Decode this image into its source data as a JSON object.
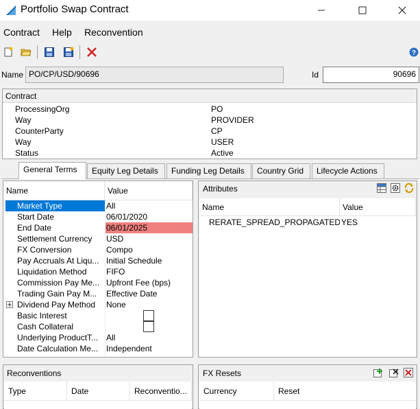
{
  "window": {
    "title": "Portfolio Swap Contract",
    "minimize": "—",
    "maximize": "☐",
    "close": "✕"
  },
  "menu": {
    "items": [
      "Contract",
      "Help",
      "Reconvention"
    ]
  },
  "name_row": {
    "name_label": "Name",
    "name_value": "PO/CP/USD/90696",
    "id_label": "Id",
    "id_value": "90696"
  },
  "contract": {
    "title": "Contract",
    "rows": [
      {
        "key": "ProcessingOrg",
        "value": "PO"
      },
      {
        "key": "Way",
        "value": "PROVIDER"
      },
      {
        "key": "CounterParty",
        "value": "CP"
      },
      {
        "key": "Way",
        "value": "USER"
      },
      {
        "key": "Status",
        "value": "Active"
      }
    ]
  },
  "tabs": [
    "General Terms",
    "Equity Leg Details",
    "Funding Leg Details",
    "Country Grid",
    "Lifecycle Actions"
  ],
  "general_terms": {
    "headers": {
      "name": "Name",
      "value": "Value"
    },
    "rows": [
      {
        "name": "Market Type",
        "value": "All"
      },
      {
        "name": "Start Date",
        "value": "06/01/2020"
      },
      {
        "name": "End Date",
        "value": "06/01/2025"
      },
      {
        "name": "Settlement Currency",
        "value": "USD"
      },
      {
        "name": "FX Conversion",
        "value": "Compo"
      },
      {
        "name": "Pay Accruals At Liqu...",
        "value": "Initial Schedule"
      },
      {
        "name": "Liquidation Method",
        "value": "FIFO"
      },
      {
        "name": "Commission Pay Me...",
        "value": "Upfront Fee (bps)"
      },
      {
        "name": "Trading Gain Pay M...",
        "value": "Effective Date"
      },
      {
        "name": "Dividend Pay Method",
        "value": "None"
      },
      {
        "name": "Basic Interest",
        "value": ""
      },
      {
        "name": "Cash Collateral",
        "value": ""
      },
      {
        "name": "Underlying ProductT...",
        "value": "All"
      },
      {
        "name": "Date Calculation Me...",
        "value": "Independent"
      }
    ]
  },
  "attributes": {
    "title": "Attributes",
    "headers": {
      "name": "Name",
      "value": "Value"
    },
    "rows": [
      {
        "name": "RERATE_SPREAD_PROPAGATED",
        "value": "YES"
      }
    ]
  },
  "reconventions": {
    "title": "Reconventions",
    "headers": [
      "Type",
      "Date",
      "Reconventio..."
    ]
  },
  "fx_resets": {
    "title": "FX Resets",
    "headers": [
      "Currency",
      "Reset"
    ]
  },
  "colors": {
    "selection": "#0078d7",
    "highlight_pink": "#f08080",
    "delete_red": "#cc2222"
  }
}
